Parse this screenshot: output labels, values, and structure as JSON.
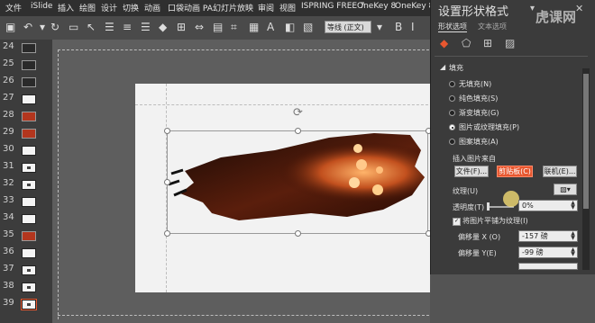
{
  "ribbon_tabs": [
    "文件",
    "iSlide",
    "插入",
    "绘图",
    "设计",
    "切换",
    "动画",
    "口袋动画 PA",
    "幻灯片放映",
    "审阅",
    "视图",
    "ISPRING FREE 7",
    "OneKey 8",
    "OneKey 8"
  ],
  "font_dropdown": "等线 (正文)",
  "slide_numbers": [
    "24",
    "25",
    "26",
    "27",
    "28",
    "29",
    "30",
    "31",
    "32",
    "33",
    "34",
    "35",
    "36",
    "37",
    "38",
    "39"
  ],
  "panel": {
    "title": "设置形状格式",
    "tab_shape": "形状选项",
    "tab_text": "文本选项",
    "section_fill": "填充",
    "fill_options": [
      "无填充(N)",
      "纯色填充(S)",
      "渐变填充(G)",
      "图片或纹理填充(P)",
      "图案填充(A)"
    ],
    "selected_fill_index": 3,
    "insert_from": "插入图片来自",
    "btn_file": "文件(F)...",
    "btn_clipboard": "剪贴板(C)",
    "btn_online": "联机(E)...",
    "texture_label": "纹理(U)",
    "transparency_label": "透明度(T)",
    "transparency_value": "0%",
    "tile_label": "将图片平铺为纹理(I)",
    "offset_x_label": "偏移量 X (O)",
    "offset_x_value": "-157 磅",
    "offset_y_label": "偏移量 Y(E)",
    "offset_y_value": "-99 磅"
  },
  "watermark": "虎课网",
  "colors": {
    "accent": "#e8572f",
    "panel_bg": "#3b3b3b",
    "ribbon_bg": "#2f2f2f"
  }
}
